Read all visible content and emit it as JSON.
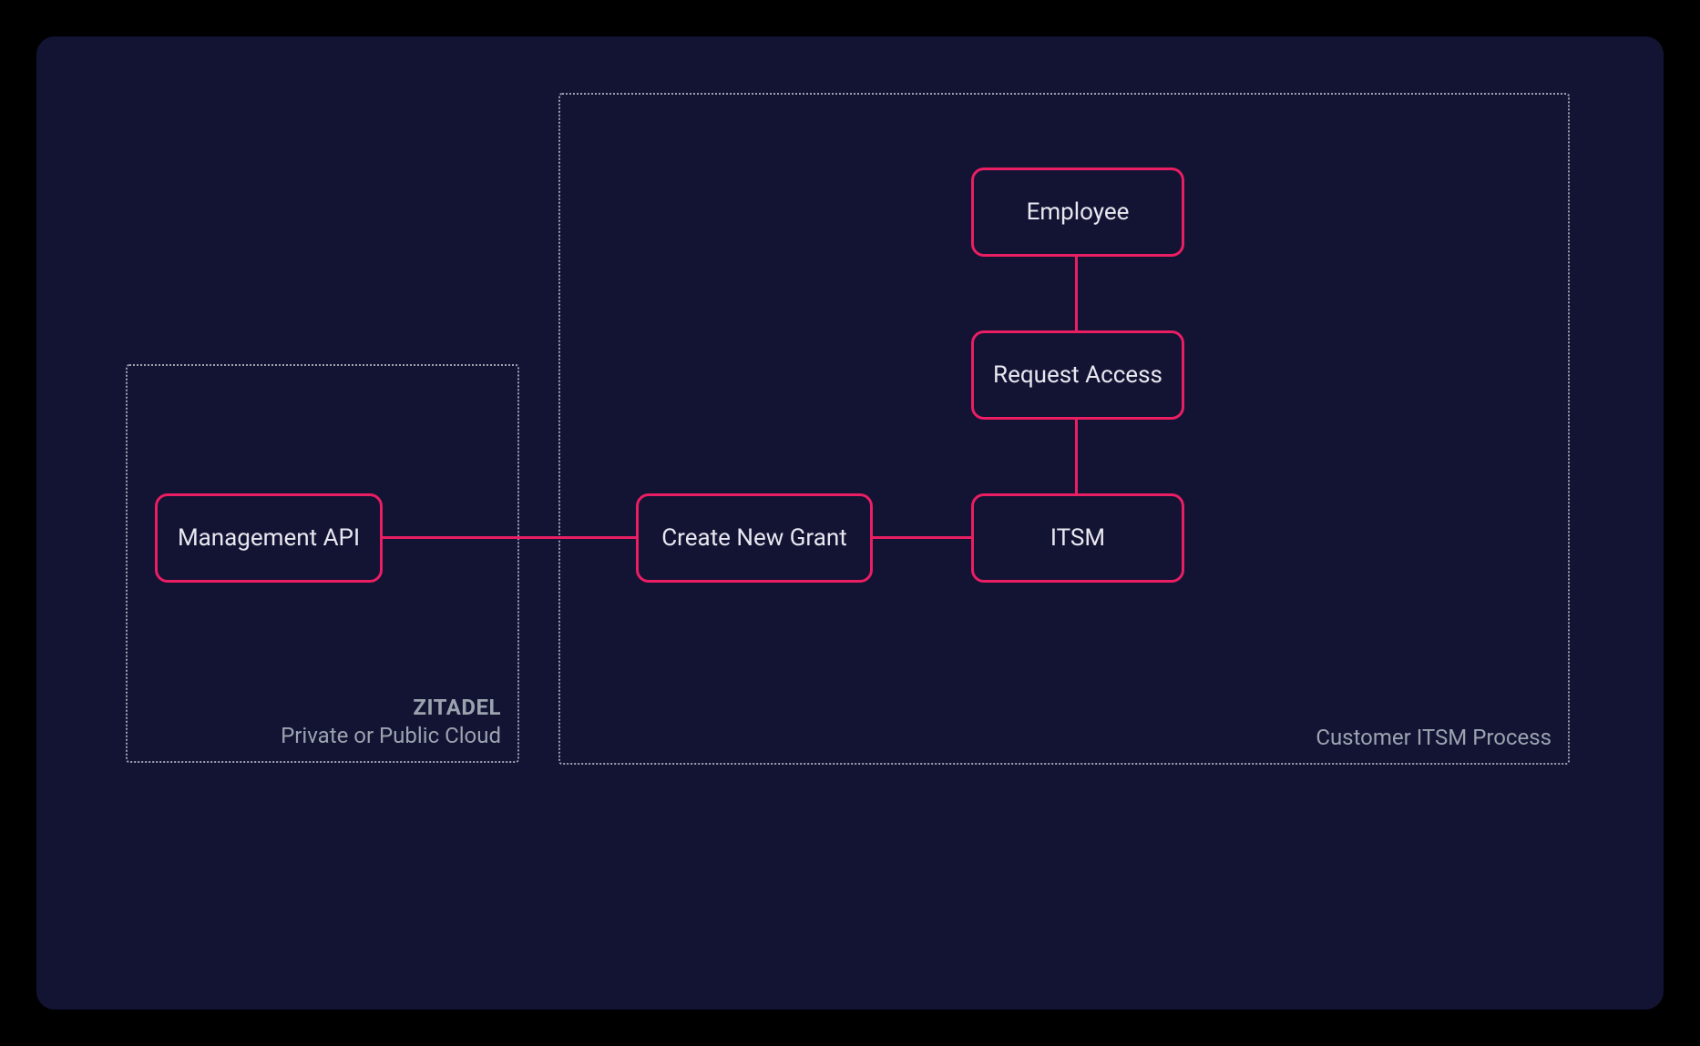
{
  "colors": {
    "accent": "#e91e63",
    "bg_outer": "#000000",
    "bg_inner": "#131334",
    "dotted": "#9ca3af",
    "text": "#e8e8f0"
  },
  "containers": {
    "left": {
      "title": "ZITADEL",
      "subtitle": "Private or Public Cloud"
    },
    "right": {
      "title": "Customer ITSM Process"
    }
  },
  "nodes": {
    "management_api": {
      "label": "Management API"
    },
    "create_new_grant": {
      "label": "Create New Grant"
    },
    "itsm": {
      "label": "ITSM"
    },
    "request_access": {
      "label": "Request Access"
    },
    "employee": {
      "label": "Employee"
    }
  }
}
